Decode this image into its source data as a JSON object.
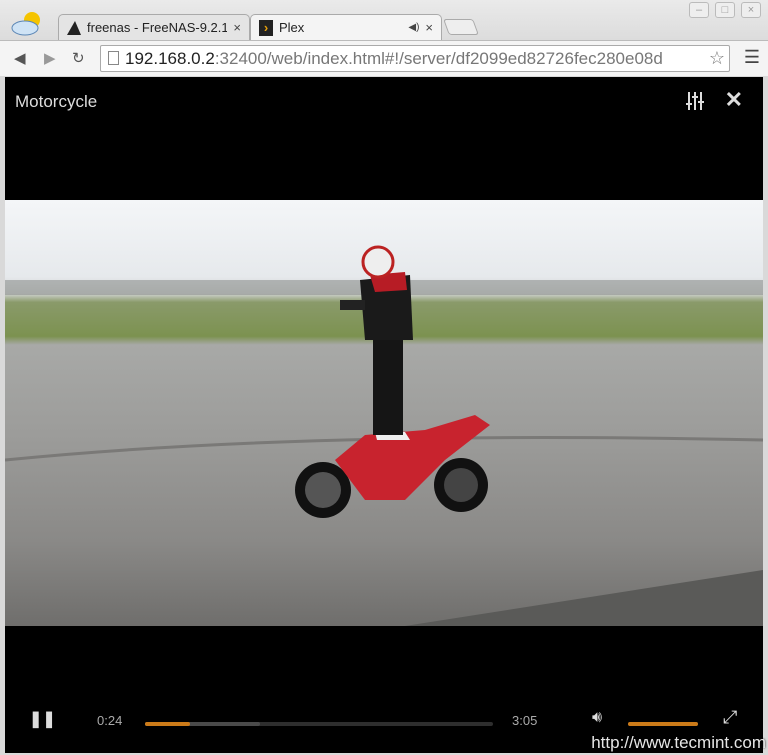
{
  "browser": {
    "tabs": [
      {
        "label": "freenas - FreeNAS-9.2.1",
        "close": "×"
      },
      {
        "label": "Plex",
        "close": "×",
        "audio_icon": "speaker-icon"
      }
    ],
    "url_host": "192.168.0.2",
    "url_rest": ":32400/web/index.html#!/server/df2099ed82726fec280e08d"
  },
  "player": {
    "title": "Motorcycle",
    "elapsed": "0:24",
    "duration": "3:05",
    "progress_percent": 13,
    "buffered_percent": 33,
    "volume_percent": 100,
    "accent": "#cc7b19"
  },
  "watermark": "http://www.tecmint.com"
}
